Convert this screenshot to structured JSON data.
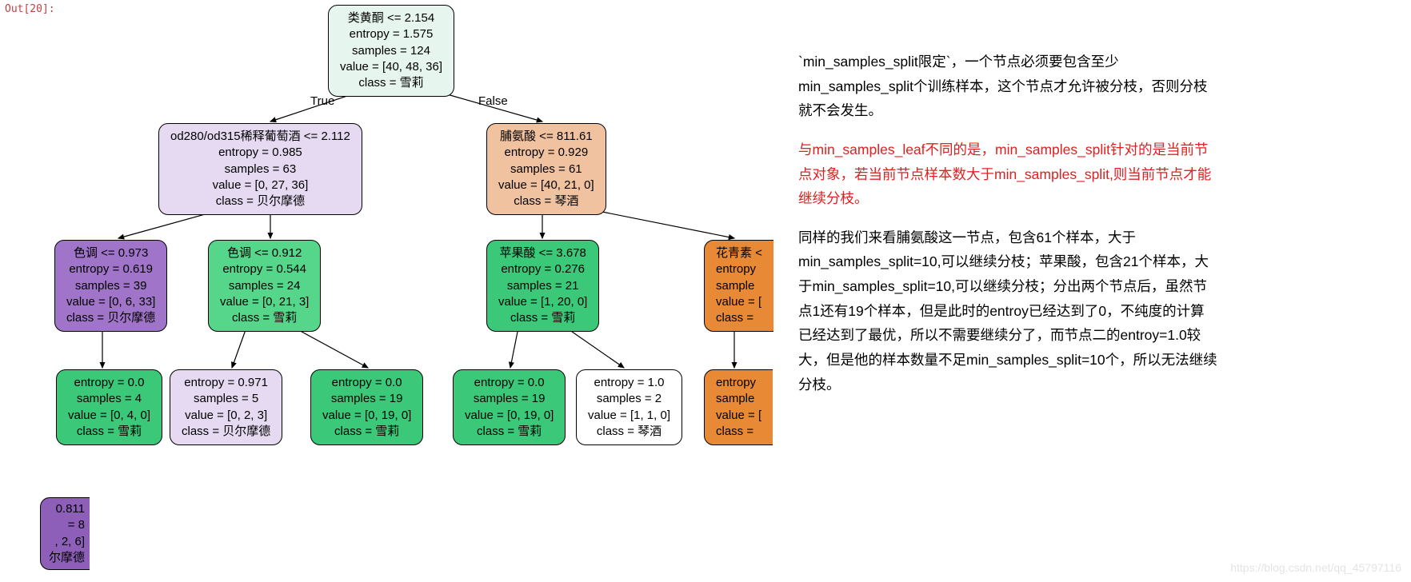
{
  "out_label": "Out[20]:",
  "edge_labels": {
    "true": "True",
    "false": "False"
  },
  "nodes": {
    "root": {
      "l1": "类黄酮 <= 2.154",
      "l2": "entropy = 1.575",
      "l3": "samples = 124",
      "l4": "value = [40, 48, 36]",
      "l5": "class = 雪莉"
    },
    "n_left": {
      "l1": "od280/od315稀释葡萄酒 <= 2.112",
      "l2": "entropy = 0.985",
      "l3": "samples = 63",
      "l4": "value = [0, 27, 36]",
      "l5": "class = 贝尔摩德"
    },
    "n_right": {
      "l1": "脯氨酸 <= 811.61",
      "l2": "entropy = 0.929",
      "l3": "samples = 61",
      "l4": "value = [40, 21, 0]",
      "l5": "class = 琴酒"
    },
    "n_ll": {
      "l1": "色调 <= 0.973",
      "l2": "entropy = 0.619",
      "l3": "samples = 39",
      "l4": "value = [0, 6, 33]",
      "l5": "class = 贝尔摩德"
    },
    "n_lr": {
      "l1": "色调 <= 0.912",
      "l2": "entropy = 0.544",
      "l3": "samples = 24",
      "l4": "value = [0, 21, 3]",
      "l5": "class = 雪莉"
    },
    "n_rl": {
      "l1": "苹果酸 <= 3.678",
      "l2": "entropy = 0.276",
      "l3": "samples = 21",
      "l4": "value = [1, 20, 0]",
      "l5": "class = 雪莉"
    },
    "n_rr": {
      "l1": "花青素 <",
      "l2": "entropy",
      "l3": "sample",
      "l4": "value = [",
      "l5": "class ="
    },
    "leaf1": {
      "l1": "entropy = 0.0",
      "l2": "samples = 4",
      "l3": "value = [0, 4, 0]",
      "l4": "class = 雪莉"
    },
    "leaf2": {
      "l1": "entropy = 0.971",
      "l2": "samples = 5",
      "l3": "value = [0, 2, 3]",
      "l4": "class = 贝尔摩德"
    },
    "leaf3": {
      "l1": "entropy = 0.0",
      "l2": "samples = 19",
      "l3": "value = [0, 19, 0]",
      "l4": "class = 雪莉"
    },
    "leaf4": {
      "l1": "entropy = 0.0",
      "l2": "samples = 19",
      "l3": "value = [0, 19, 0]",
      "l4": "class = 雪莉"
    },
    "leaf5": {
      "l1": "entropy = 1.0",
      "l2": "samples = 2",
      "l3": "value = [1, 1, 0]",
      "l4": "class = 琴酒"
    },
    "leaf6": {
      "l1": "entropy",
      "l2": "sample",
      "l3": "value = [",
      "l4": "class ="
    },
    "frag": {
      "l1": "0.811",
      "l2": "= 8",
      "l3": ", 2, 6]",
      "l4": "尔摩德"
    }
  },
  "text": {
    "p1": "`min_samples_split限定`，一个节点必须要包含至少min_samples_split个训练样本，这个节点才允许被分枝，否则分枝就不会发生。",
    "p2": "与min_samples_leaf不同的是，min_samples_split针对的是当前节点对象，若当前节点样本数大于min_samples_split,则当前节点才能继续分枝。",
    "p3": "同样的我们来看脯氨酸这一节点，包含61个样本，大于min_samples_split=10,可以继续分枝；苹果酸，包含21个样本，大于min_samples_split=10,可以继续分枝；分出两个节点后，虽然节点1还有19个样本，但是此时的entroy已经达到了0，不纯度的计算已经达到了最优，所以不需要继续分了，而节点二的entroy=1.0较大，但是他的样本数量不足min_samples_split=10个，所以无法继续分枝。"
  },
  "watermark": "https://blog.csdn.net/qq_45797116"
}
